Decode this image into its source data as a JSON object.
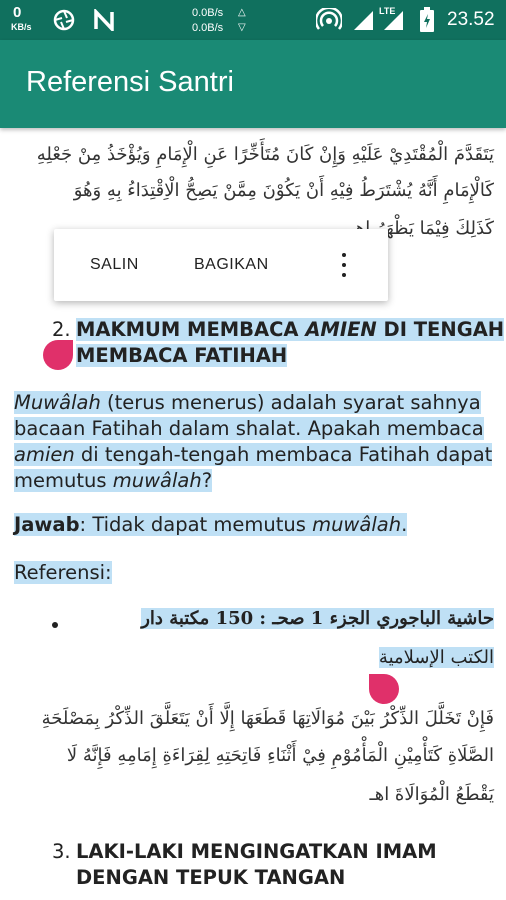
{
  "status_bar": {
    "net_speed": "0",
    "net_unit": "KB/s",
    "up_speed": "0.0B/s",
    "down_speed": "0.0B/s",
    "network_type": "LTE",
    "time": "23.52",
    "icons": [
      "aperture-icon",
      "n-icon",
      "hotspot-icon",
      "signal-icon",
      "lte-signal-icon",
      "battery-icon"
    ]
  },
  "app_bar": {
    "title": "Referensi Santri",
    "color": "#1a8a75"
  },
  "content": {
    "arabic_top": [
      "يَتَقَدَّمَ الْمُقْتَدِيْ عَلَيْهِ وَإِنْ كَانَ مُتَأَخِّرًا عَنِ الْإِمَامِ وَيُؤْخَذُ مِنْ جَعْلِهِ",
      "كَالْإِمَامِ أَنَّهُ يُشْتَرَطُ فِيْهِ أَنْ يَكُوْنَ مِمَّنْ يَصِحُّ الْاِقْتِدَاءُ بِهِ وَهُوَ",
      "كَذَلِكَ فِيْمَا يَظْهَرُ اهـ"
    ],
    "section2": {
      "number": "2.",
      "title_part1": "MAKMUM MEMBACA ",
      "title_italic": "AMIEN",
      "title_part2": " DI TENGAH",
      "title_line2": "MEMBACA FATIHAH"
    },
    "para1": {
      "line1_italic": "Muwâlah",
      "line1_rest": " (terus menerus) adalah syarat sahnya",
      "line2": "bacaan Fatihah dalam shalat. Apakah membaca",
      "line3_italic": "amien",
      "line3_rest": " di tengah-tengah membaca Fatihah dapat",
      "line4_start": "memutus ",
      "line4_italic": "muwâlah",
      "line4_end": "?"
    },
    "answer": {
      "label": "Jawab",
      "text": ": Tidak dapat memutus ",
      "italic": "muwâlah",
      "end": "."
    },
    "reference_label": "Referensi:",
    "reference_book_line1": "حاشية الباجوري الجزء 1 صحـ : 150 مكتبة دار",
    "reference_book_line2": "الكتب الإسلامية",
    "arabic_quote": [
      "فَإِنْ تَخَلَّلَ الذِّكْرُ بَيْنَ مُوَالَاتِهَا قَطَعَهَا إِلَّا أَنْ يَتَعَلَّقَ الذِّكْرُ بِمَصْلَحَةِ",
      "الصَّلَاةِ كَتَأْمِيْنِ الْمَأْمُوْمِ فِيْ أَثْنَاءِ فَاتِحَتِهِ لِقِرَاءَةِ إِمَامِهِ فَإِنَّهُ لَا",
      "يَقْطَعُ الْمُوَالَاةَ اهـ"
    ],
    "section3": {
      "number": "3.",
      "title_line1": "LAKI-LAKI MENGINGATKAN IMAM",
      "title_line2": "DENGAN TEPUK TANGAN"
    }
  },
  "selection_menu": {
    "copy_label": "SALIN",
    "share_label": "BAGIKAN",
    "more_icon": "more-vert-icon"
  },
  "colors": {
    "status_bar": "#10705e",
    "app_bar": "#1a8a75",
    "selection_highlight": "#bfe0f5",
    "selection_handle": "#e0306a"
  }
}
